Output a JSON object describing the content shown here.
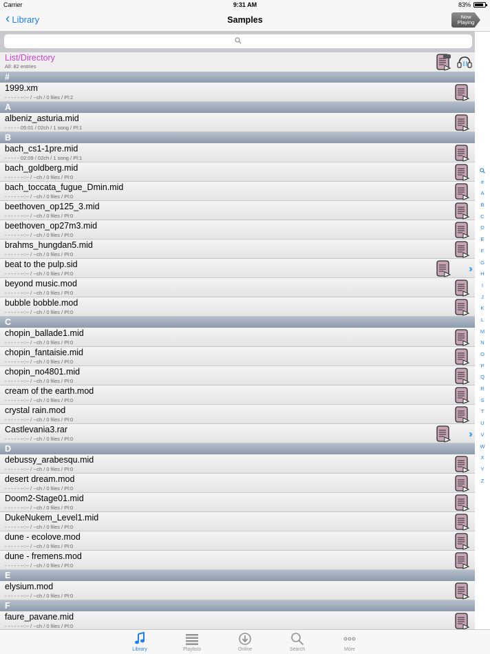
{
  "status": {
    "carrier": "Carrier",
    "time": "9:31 AM",
    "battery": "83%"
  },
  "nav": {
    "back": "Library",
    "title": "Samples",
    "now_playing_line1": "Now",
    "now_playing_line2": "Playing"
  },
  "search": {
    "placeholder": ""
  },
  "list_header": {
    "title": "List/Directory",
    "subtitle": "All: 82 entries"
  },
  "sections": [
    {
      "letter": "#",
      "rows": [
        {
          "name": "1999.xm",
          "info": "- - - - -    --:-- / --ch / 0 files / Pl:2"
        }
      ]
    },
    {
      "letter": "A",
      "rows": [
        {
          "name": "albeniz_asturia.mid",
          "info": "- - - - -    05:01 / 02ch / 1 song / Pl:1"
        }
      ]
    },
    {
      "letter": "B",
      "rows": [
        {
          "name": "bach_cs1-1pre.mid",
          "info": "- - - - -    02:09 / 02ch / 1 song / Pl:1"
        },
        {
          "name": "bach_goldberg.mid",
          "info": "- - - - -    --:-- / --ch / 0 files / Pl:0"
        },
        {
          "name": "bach_toccata_fugue_Dmin.mid",
          "info": "- - - - -    --:-- / --ch / 0 files / Pl:0"
        },
        {
          "name": "beethoven_op125_3.mid",
          "info": "- - - - -    --:-- / --ch / 0 files / Pl:0"
        },
        {
          "name": "beethoven_op27m3.mid",
          "info": "- - - - -    --:-- / --ch / 0 files / Pl:0"
        },
        {
          "name": "brahms_hungdan5.mid",
          "info": "- - - - -    --:-- / --ch / 0 files / Pl:0"
        },
        {
          "name": "beat to the pulp.sid",
          "info": "- - - - -    --:-- / --ch / 0 files / Pl:0",
          "archive": true
        },
        {
          "name": "beyond music.mod",
          "info": "- - - - -    --:-- / --ch / 0 files / Pl:0"
        },
        {
          "name": "bubble bobble.mod",
          "info": "- - - - -    --:-- / --ch / 0 files / Pl:0"
        }
      ]
    },
    {
      "letter": "C",
      "rows": [
        {
          "name": "chopin_ballade1.mid",
          "info": "- - - - -    --:-- / --ch / 0 files / Pl:0"
        },
        {
          "name": "chopin_fantaisie.mid",
          "info": "- - - - -    --:-- / --ch / 0 files / Pl:0"
        },
        {
          "name": "chopin_no4801.mid",
          "info": "- - - - -    --:-- / --ch / 0 files / Pl:0"
        },
        {
          "name": "cream of the earth.mod",
          "info": "- - - - -    --:-- / --ch / 0 files / Pl:0"
        },
        {
          "name": "crystal rain.mod",
          "info": "- - - - -    --:-- / --ch / 0 files / Pl:0"
        },
        {
          "name": "Castlevania3.rar",
          "info": "- - - - -    --:-- / --ch / 0 files / Pl:0",
          "archive": true
        }
      ]
    },
    {
      "letter": "D",
      "rows": [
        {
          "name": "debussy_arabesqu.mid",
          "info": "- - - - -    --:-- / --ch / 0 files / Pl:0"
        },
        {
          "name": "desert dream.mod",
          "info": "- - - - -    --:-- / --ch / 0 files / Pl:0"
        },
        {
          "name": "Doom2-Stage01.mid",
          "info": "- - - - -    --:-- / --ch / 0 files / Pl:0"
        },
        {
          "name": "DukeNukem_Level1.mid",
          "info": "- - - - -    --:-- / --ch / 0 files / Pl:0"
        },
        {
          "name": "dune - ecolove.mod",
          "info": "- - - - -    --:-- / --ch / 0 files / Pl:0"
        },
        {
          "name": "dune - fremens.mod",
          "info": "- - - - -    --:-- / --ch / 0 files / Pl:0"
        }
      ]
    },
    {
      "letter": "E",
      "rows": [
        {
          "name": "elysium.mod",
          "info": "- - - - -    --:-- / --ch / 0 files / Pl:0"
        }
      ]
    },
    {
      "letter": "F",
      "rows": [
        {
          "name": "faure_pavane.mid",
          "info": "- - - - -    --:-- / --ch / 0 files / Pl:0"
        }
      ]
    }
  ],
  "index": [
    "#",
    "A",
    "B",
    "C",
    "D",
    "E",
    "F",
    "G",
    "H",
    "I",
    "J",
    "K",
    "L",
    "M",
    "N",
    "O",
    "P",
    "Q",
    "R",
    "S",
    "T",
    "U",
    "V",
    "W",
    "X",
    "Y",
    "Z"
  ],
  "tabs": [
    {
      "label": "Library",
      "icon": "music-note-icon",
      "active": true
    },
    {
      "label": "Playlists",
      "icon": "list-icon",
      "active": false
    },
    {
      "label": "Online",
      "icon": "download-icon",
      "active": false
    },
    {
      "label": "Search",
      "icon": "search-icon",
      "active": false
    },
    {
      "label": "More",
      "icon": "more-icon",
      "active": false
    }
  ],
  "colors": {
    "accent": "#1e7cf5",
    "list_title": "#cc44cc",
    "section": "#9aa6b5",
    "doc_icon": "#c8a5b4"
  }
}
